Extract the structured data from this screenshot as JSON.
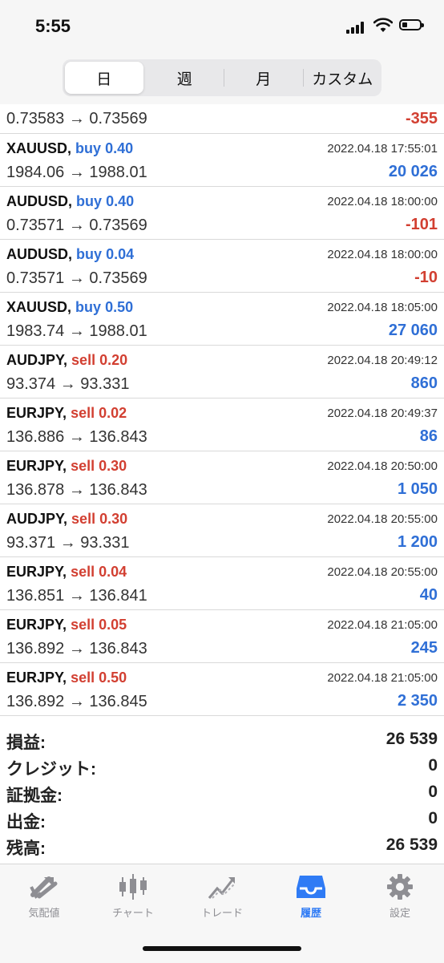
{
  "status": {
    "time": "5:55"
  },
  "segments": [
    "日",
    "週",
    "月",
    "カスタム"
  ],
  "first_row": {
    "prices": "0.73583 → 0.73569",
    "pl": "-355"
  },
  "trades": [
    {
      "symbol": "XAUUSD,",
      "side": "buy",
      "lots": "0.40",
      "date": "2022.04.18 17:55:01",
      "prices": "1984.06 → 1988.01",
      "pl": "20 026"
    },
    {
      "symbol": "AUDUSD,",
      "side": "buy",
      "lots": "0.40",
      "date": "2022.04.18 18:00:00",
      "prices": "0.73571 → 0.73569",
      "pl": "-101"
    },
    {
      "symbol": "AUDUSD,",
      "side": "buy",
      "lots": "0.04",
      "date": "2022.04.18 18:00:00",
      "prices": "0.73571 → 0.73569",
      "pl": "-10"
    },
    {
      "symbol": "XAUUSD,",
      "side": "buy",
      "lots": "0.50",
      "date": "2022.04.18 18:05:00",
      "prices": "1983.74 → 1988.01",
      "pl": "27 060"
    },
    {
      "symbol": "AUDJPY,",
      "side": "sell",
      "lots": "0.20",
      "date": "2022.04.18 20:49:12",
      "prices": "93.374 → 93.331",
      "pl": "860"
    },
    {
      "symbol": "EURJPY,",
      "side": "sell",
      "lots": "0.02",
      "date": "2022.04.18 20:49:37",
      "prices": "136.886 → 136.843",
      "pl": "86"
    },
    {
      "symbol": "EURJPY,",
      "side": "sell",
      "lots": "0.30",
      "date": "2022.04.18 20:50:00",
      "prices": "136.878 → 136.843",
      "pl": "1 050"
    },
    {
      "symbol": "AUDJPY,",
      "side": "sell",
      "lots": "0.30",
      "date": "2022.04.18 20:55:00",
      "prices": "93.371 → 93.331",
      "pl": "1 200"
    },
    {
      "symbol": "EURJPY,",
      "side": "sell",
      "lots": "0.04",
      "date": "2022.04.18 20:55:00",
      "prices": "136.851 → 136.841",
      "pl": "40"
    },
    {
      "symbol": "EURJPY,",
      "side": "sell",
      "lots": "0.05",
      "date": "2022.04.18 21:05:00",
      "prices": "136.892 → 136.843",
      "pl": "245"
    },
    {
      "symbol": "EURJPY,",
      "side": "sell",
      "lots": "0.50",
      "date": "2022.04.18 21:05:00",
      "prices": "136.892 → 136.845",
      "pl": "2 350"
    }
  ],
  "summary": [
    {
      "label": "損益:",
      "value": "26 539"
    },
    {
      "label": "クレジット:",
      "value": "0"
    },
    {
      "label": "証拠金:",
      "value": "0"
    },
    {
      "label": "出金:",
      "value": "0"
    },
    {
      "label": "残高:",
      "value": "26 539"
    }
  ],
  "tabs": [
    {
      "label": "気配値",
      "icon": "quotes-icon"
    },
    {
      "label": "チャート",
      "icon": "chart-icon"
    },
    {
      "label": "トレード",
      "icon": "trade-icon"
    },
    {
      "label": "履歴",
      "icon": "history-icon",
      "active": true
    },
    {
      "label": "設定",
      "icon": "settings-icon"
    }
  ],
  "colors": {
    "buy": "#2f6fd6",
    "sell": "#d23f31",
    "accent": "#2f7bf5"
  }
}
